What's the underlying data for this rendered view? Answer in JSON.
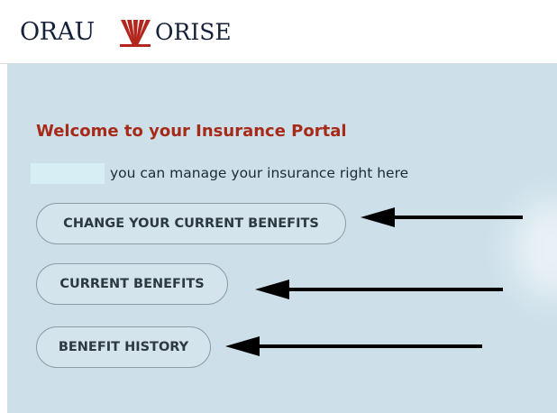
{
  "header": {
    "logo_left": "ORAU",
    "logo_right": "ORISE"
  },
  "portal": {
    "title": "Welcome to your Insurance Portal",
    "subtitle": "you can manage your insurance right here"
  },
  "actions": {
    "change_benefits": "CHANGE YOUR CURRENT BENEFITS",
    "current_benefits": "CURRENT BENEFITS",
    "benefit_history": "BENEFIT HISTORY"
  },
  "colors": {
    "title": "#a72a18",
    "background": "#cde0ea",
    "logo_mark": "#b3261e"
  }
}
